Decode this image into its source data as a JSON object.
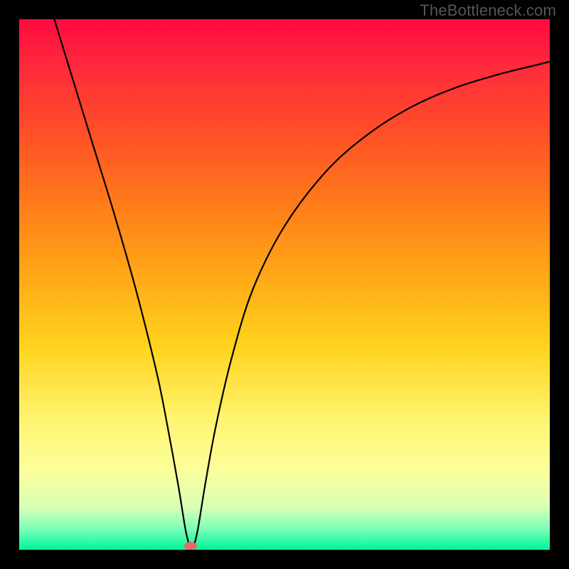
{
  "watermark": "TheBottleneck.com",
  "chart_data": {
    "type": "line",
    "title": "",
    "xlabel": "",
    "ylabel": "",
    "xlim": [
      0,
      100
    ],
    "ylim": [
      0,
      100
    ],
    "gradient_stops": [
      {
        "pos": 0,
        "color": "#ff0a40"
      },
      {
        "pos": 10,
        "color": "#ff2e3a"
      },
      {
        "pos": 22,
        "color": "#ff5126"
      },
      {
        "pos": 35,
        "color": "#ff7c1a"
      },
      {
        "pos": 48,
        "color": "#ffa716"
      },
      {
        "pos": 62,
        "color": "#ffd41e"
      },
      {
        "pos": 76,
        "color": "#fff574"
      },
      {
        "pos": 85,
        "color": "#fbff9a"
      },
      {
        "pos": 92,
        "color": "#d9ffb6"
      },
      {
        "pos": 96,
        "color": "#7dffb8"
      },
      {
        "pos": 100,
        "color": "#00f59b"
      }
    ],
    "series": [
      {
        "name": "bottleneck-curve",
        "x": [
          6,
          10,
          14,
          18,
          22,
          26,
          28,
          30,
          31.5,
          32.5,
          33.5,
          35,
          37,
          40,
          44,
          50,
          58,
          66,
          74,
          82,
          90,
          98,
          100
        ],
        "y": [
          102,
          89,
          76,
          63,
          49,
          33,
          23,
          12,
          3,
          0.5,
          3,
          12,
          23,
          36,
          49,
          61,
          71.5,
          78.5,
          83.5,
          87,
          89.5,
          91.5,
          92
        ]
      }
    ],
    "marker": {
      "x": 32.3,
      "y": 0.7,
      "color": "#e46a62",
      "rx": 1.2,
      "ry": 0.8
    }
  }
}
